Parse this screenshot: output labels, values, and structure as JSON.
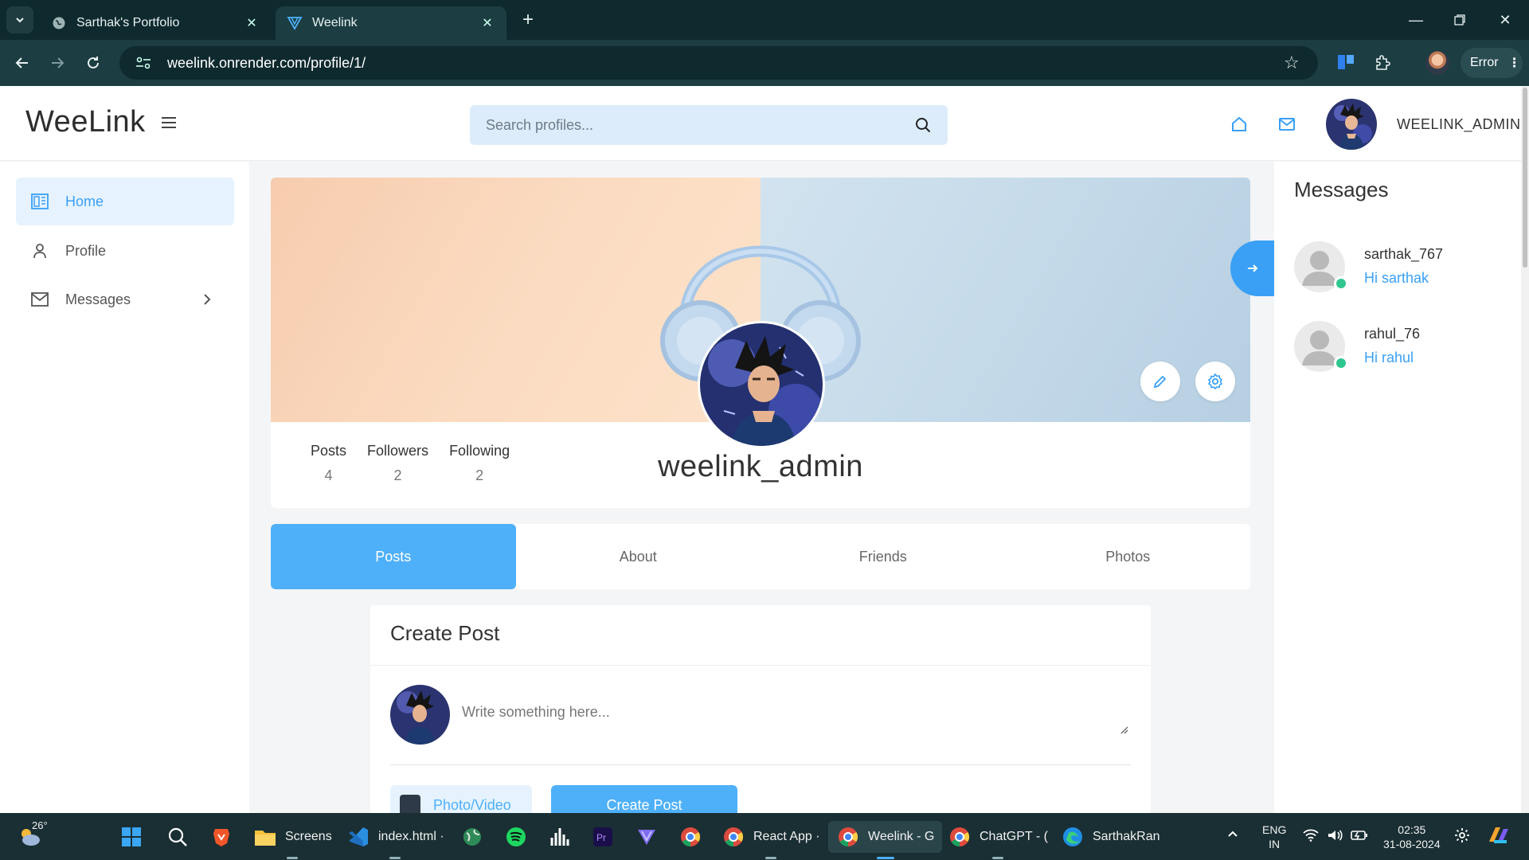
{
  "browser": {
    "tabs": [
      {
        "title": "Sarthak's Portfolio",
        "active": false
      },
      {
        "title": "Weelink",
        "active": true
      }
    ],
    "url": "weelink.onrender.com/profile/1/",
    "error_label": "Error"
  },
  "header": {
    "logo": "WeeLink",
    "search_placeholder": "Search profiles...",
    "username": "WEELINK_ADMIN"
  },
  "sidebar": {
    "items": [
      {
        "label": "Home",
        "active": true
      },
      {
        "label": "Profile",
        "active": false
      },
      {
        "label": "Messages",
        "active": false
      }
    ]
  },
  "profile": {
    "username": "weelink_admin",
    "stats": [
      {
        "label": "Posts",
        "value": "4"
      },
      {
        "label": "Followers",
        "value": "2"
      },
      {
        "label": "Following",
        "value": "2"
      }
    ]
  },
  "tabs": [
    {
      "label": "Posts",
      "active": true
    },
    {
      "label": "About",
      "active": false
    },
    {
      "label": "Friends",
      "active": false
    },
    {
      "label": "Photos",
      "active": false
    }
  ],
  "create_post": {
    "title": "Create Post",
    "placeholder": "Write something here...",
    "photo_label": "Photo/Video",
    "submit_label": "Create Post"
  },
  "messages": {
    "title": "Messages",
    "items": [
      {
        "name": "sarthak_767",
        "text": "Hi sarthak"
      },
      {
        "name": "rahul_76",
        "text": "Hi rahul"
      }
    ]
  },
  "taskbar": {
    "weather": "26°",
    "apps": [
      {
        "label": "Screens"
      },
      {
        "label": "index.html ·"
      },
      {
        "label": "React App ·"
      },
      {
        "label": "Weelink - G"
      },
      {
        "label": "ChatGPT - ("
      },
      {
        "label": "SarthakRan"
      }
    ],
    "lang_top": "ENG",
    "lang_bottom": "IN",
    "time": "02:35",
    "date": "31-08-2024"
  },
  "colors": {
    "accent": "#3aa0f5",
    "accent_light": "#e6f3fe",
    "online": "#2fc78f"
  }
}
